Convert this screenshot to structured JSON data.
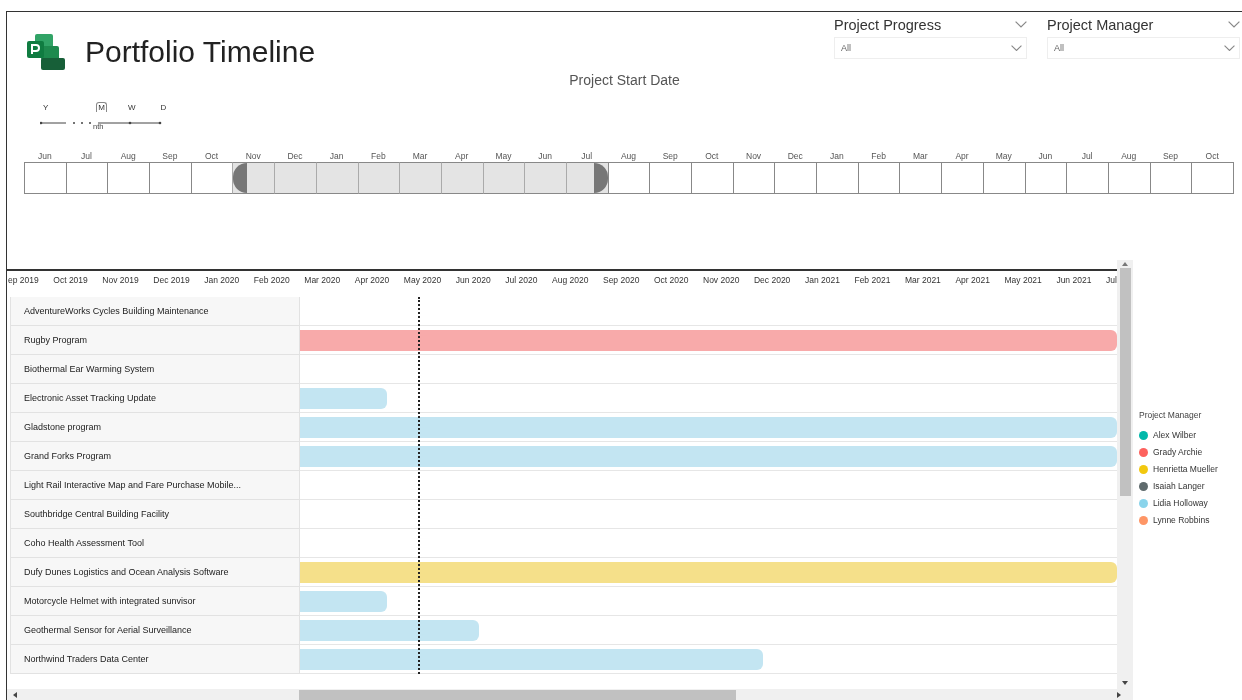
{
  "header": {
    "title": "Portfolio Timeline"
  },
  "filters": [
    {
      "title": "Project Progress",
      "value": "All"
    },
    {
      "title": "Project Manager",
      "value": "All"
    }
  ],
  "date_slicer": {
    "title": "Project Start Date",
    "granularity": [
      {
        "label": "Y",
        "selected": false
      },
      {
        "label": "M",
        "selected": true,
        "caption": "nth"
      },
      {
        "label": "W",
        "selected": false
      },
      {
        "label": "D",
        "selected": false
      }
    ],
    "months": [
      {
        "label": "Jun",
        "selected": false
      },
      {
        "label": "Jul",
        "selected": false
      },
      {
        "label": "Aug",
        "selected": false
      },
      {
        "label": "Sep",
        "selected": false
      },
      {
        "label": "Oct",
        "selected": false
      },
      {
        "label": "Nov",
        "selected": true
      },
      {
        "label": "Dec",
        "selected": true
      },
      {
        "label": "Jan",
        "selected": true
      },
      {
        "label": "Feb",
        "selected": true
      },
      {
        "label": "Mar",
        "selected": true
      },
      {
        "label": "Apr",
        "selected": true
      },
      {
        "label": "May",
        "selected": true
      },
      {
        "label": "Jun",
        "selected": true
      },
      {
        "label": "Jul",
        "selected": true
      },
      {
        "label": "Aug",
        "selected": false
      },
      {
        "label": "Sep",
        "selected": false
      },
      {
        "label": "Oct",
        "selected": false
      },
      {
        "label": "Nov",
        "selected": false
      },
      {
        "label": "Dec",
        "selected": false
      },
      {
        "label": "Jan",
        "selected": false
      },
      {
        "label": "Feb",
        "selected": false
      },
      {
        "label": "Mar",
        "selected": false
      },
      {
        "label": "Apr",
        "selected": false
      },
      {
        "label": "May",
        "selected": false
      },
      {
        "label": "Jun",
        "selected": false
      },
      {
        "label": "Jul",
        "selected": false
      },
      {
        "label": "Aug",
        "selected": false
      },
      {
        "label": "Sep",
        "selected": false
      },
      {
        "label": "Oct",
        "selected": false
      }
    ]
  },
  "gantt": {
    "axis": [
      "ep 2019",
      "Oct 2019",
      "Nov 2019",
      "Dec 2019",
      "Jan 2020",
      "Feb 2020",
      "Mar 2020",
      "Apr 2020",
      "May 2020",
      "Jun 2020",
      "Jul 2020",
      "Aug 2020",
      "Sep 2020",
      "Oct 2020",
      "Nov 2020",
      "Dec 2020",
      "Jan 2021",
      "Feb 2021",
      "Mar 2021",
      "Apr 2021",
      "May 2021",
      "Jun 2021",
      "Jul"
    ],
    "rows": [
      {
        "name": "AdventureWorks Cycles Building Maintenance"
      },
      {
        "name": "Rugby Program",
        "level": 1,
        "color": "#f8aaaa"
      },
      {
        "name": "Biothermal Ear Warming System"
      },
      {
        "name": "Electronic Asset Tracking Update",
        "level": 0.106,
        "color": "#c3e5f2"
      },
      {
        "name": "Gladstone program",
        "level": 1,
        "color": "#c3e5f2"
      },
      {
        "name": "Grand Forks Program",
        "level": 1,
        "color": "#c3e5f2"
      },
      {
        "name": "Light Rail Interactive Map and Fare Purchase Mobile..."
      },
      {
        "name": "Southbridge Central Building Facility"
      },
      {
        "name": "Coho Health Assessment Tool"
      },
      {
        "name": "Dufy Dunes Logistics and Ocean Analysis Software",
        "level": 1,
        "color": "#f5e08a"
      },
      {
        "name": "Motorcycle Helmet with integrated sunvisor",
        "level": 0.106,
        "color": "#c3e5f2"
      },
      {
        "name": "Geothermal Sensor for Aerial Surveillance",
        "level": 0.219,
        "color": "#c3e5f2"
      },
      {
        "name": "Northwind Traders Data Center",
        "level": 0.567,
        "color": "#c3e5f2"
      }
    ]
  },
  "legend": {
    "title": "Project Manager",
    "items": [
      {
        "name": "Alex Wilber",
        "color": "#01b8aa"
      },
      {
        "name": "Grady Archie",
        "color": "#fd625e"
      },
      {
        "name": "Henrietta Mueller",
        "color": "#f2c80f"
      },
      {
        "name": "Isaiah Langer",
        "color": "#5f6b6d"
      },
      {
        "name": "Lidia Holloway",
        "color": "#8ad4eb"
      },
      {
        "name": "Lynne Robbins",
        "color": "#fe9666"
      }
    ]
  }
}
